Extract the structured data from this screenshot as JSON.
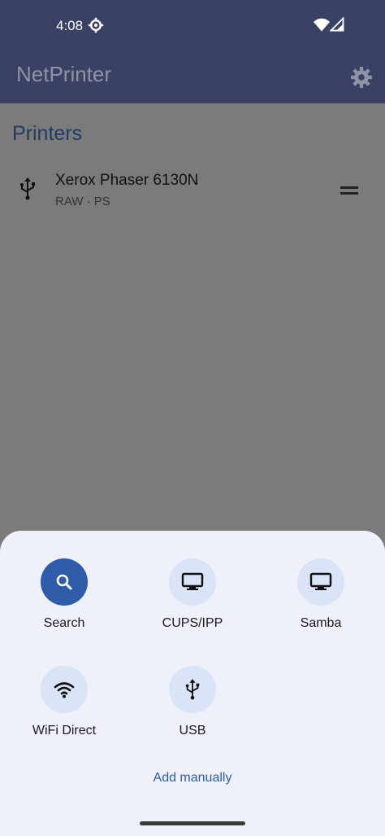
{
  "status_bar": {
    "time": "4:08"
  },
  "app_bar": {
    "title": "NetPrinter"
  },
  "printers": {
    "section_title": "Printers",
    "items": [
      {
        "name": "Xerox Phaser 6130N",
        "subtitle": "RAW · PS",
        "icon": "usb-icon"
      }
    ]
  },
  "sheet": {
    "options": [
      {
        "label": "Search",
        "icon": "search-icon"
      },
      {
        "label": "CUPS/IPP",
        "icon": "monitor-icon"
      },
      {
        "label": "Samba",
        "icon": "monitor-icon"
      },
      {
        "label": "WiFi Direct",
        "icon": "wifi-icon"
      },
      {
        "label": "USB",
        "icon": "usb-icon"
      }
    ],
    "add_manually": "Add manually"
  },
  "colors": {
    "app_bar": "#3b4164",
    "accent": "#2f5ca8",
    "sheet_bg": "#eef0fa",
    "chip_bg": "#dbe3f7",
    "scrim": "#7b7b7b"
  }
}
